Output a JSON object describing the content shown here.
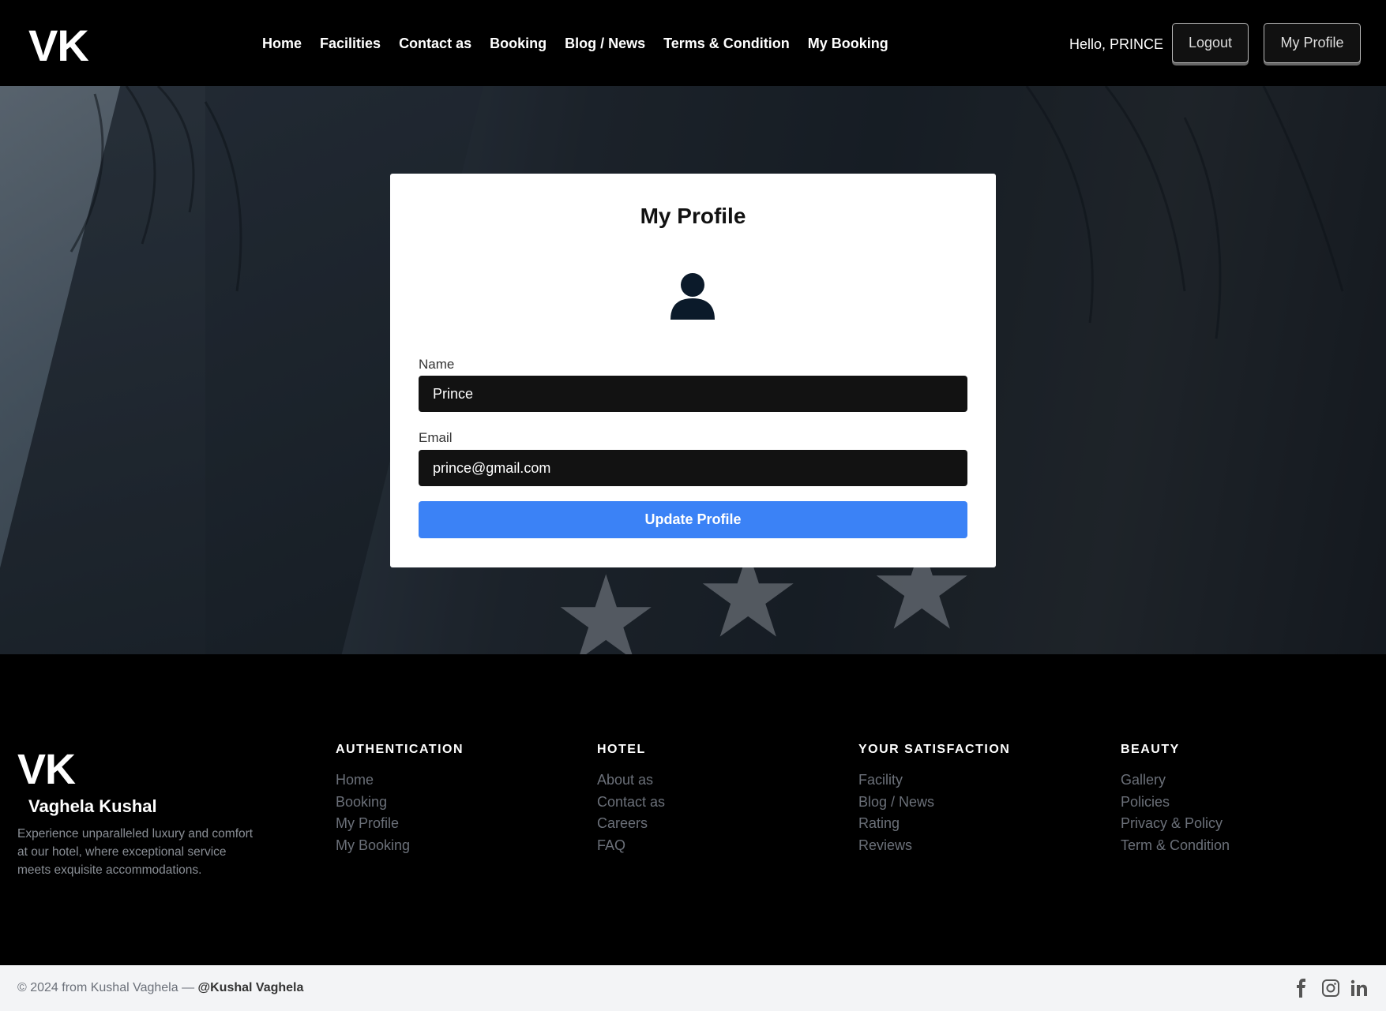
{
  "header": {
    "logo": "VK",
    "nav": [
      "Home",
      "Facilities",
      "Contact as",
      "Booking",
      "Blog / News",
      "Terms & Condition",
      "My Booking"
    ],
    "greeting": "Hello, PRINCE",
    "logout_label": "Logout",
    "profile_label": "My Profile"
  },
  "profile_card": {
    "title": "My Profile",
    "name_label": "Name",
    "name_value": "Prince",
    "email_label": "Email",
    "email_value": "prince@gmail.com",
    "update_label": "Update Profile",
    "icon": "user-icon"
  },
  "footer": {
    "logo": "VK",
    "brand_name": "Vaghela Kushal",
    "description": "Experience unparalleled luxury and comfort at our hotel, where exceptional service meets exquisite accommodations.",
    "columns": [
      {
        "title": "AUTHENTICATION",
        "links": [
          "Home",
          "Booking",
          "My Profile",
          "My Booking"
        ]
      },
      {
        "title": "HOTEL",
        "links": [
          "About as",
          "Contact as",
          "Careers",
          "FAQ"
        ]
      },
      {
        "title": "YOUR SATISFACTION",
        "links": [
          "Facility",
          "Blog / News",
          "Rating",
          "Reviews"
        ]
      },
      {
        "title": "BEAUTY",
        "links": [
          "Gallery",
          "Policies",
          "Privacy & Policy",
          "Term & Condition"
        ]
      }
    ]
  },
  "bottom": {
    "copyright": "© 2024 from Kushal Vaghela — ",
    "handle": "@Kushal Vaghela",
    "social": [
      "facebook-icon",
      "instagram-icon",
      "linkedin-icon"
    ]
  },
  "colors": {
    "accent": "#3b82f6",
    "background": "#000000",
    "input_bg": "#121212"
  }
}
